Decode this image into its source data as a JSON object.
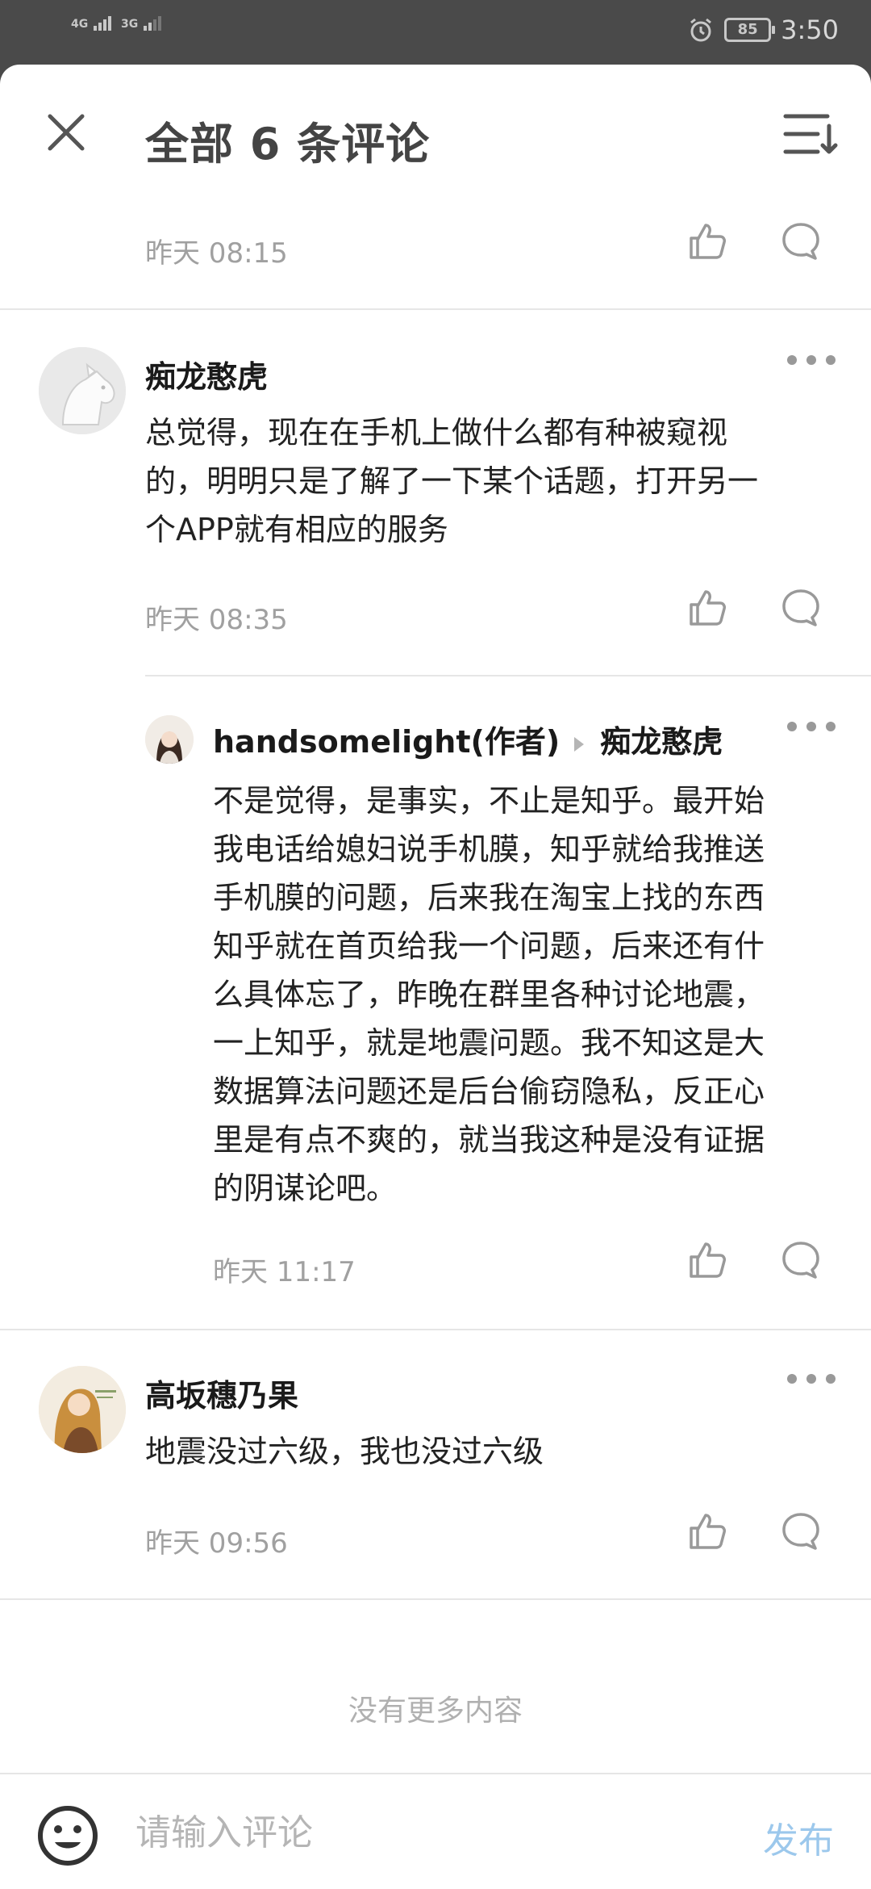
{
  "status_bar": {
    "network_1": "4G",
    "network_2": "3G",
    "battery": "85",
    "time": "3:50"
  },
  "header": {
    "title": "全部 6 条评论"
  },
  "top_partial": {
    "time": "昨天 08:15"
  },
  "comments": [
    {
      "author": "痴龙憨虎",
      "text_lines": [
        "总觉得，现在在手机上做什么都有种被窥视",
        "的，明明只是了解了一下某个话题，打开另一",
        "个APP就有相应的服务"
      ],
      "time": "昨天 08:35"
    },
    {
      "author": "handsomelight(作者)",
      "reply_to": "痴龙憨虎",
      "text_lines": [
        "不是觉得，是事实，不止是知乎。最开始",
        "我电话给媳妇说手机膜，知乎就给我推送",
        "手机膜的问题，后来我在淘宝上找的东西",
        "知乎就在首页给我一个问题，后来还有什",
        "么具体忘了，昨晚在群里各种讨论地震，",
        "一上知乎，就是地震问题。我不知这是大",
        "数据算法问题还是后台偷窃隐私，反正心",
        "里是有点不爽的，就当我这种是没有证据",
        "的阴谋论吧。"
      ],
      "time": "昨天 11:17"
    },
    {
      "author": "高坂穗乃果",
      "text_lines": [
        "地震没过六级，我也没过六级"
      ],
      "time": "昨天 09:56"
    }
  ],
  "footer_note": "没有更多内容",
  "input_bar": {
    "placeholder": "请输入评论",
    "publish_label": "发布"
  },
  "colors": {
    "accent_disabled": "#9cc8ec",
    "secondary_text": "#a0a0a0",
    "status_bar_bg": "#4a4a4a"
  }
}
